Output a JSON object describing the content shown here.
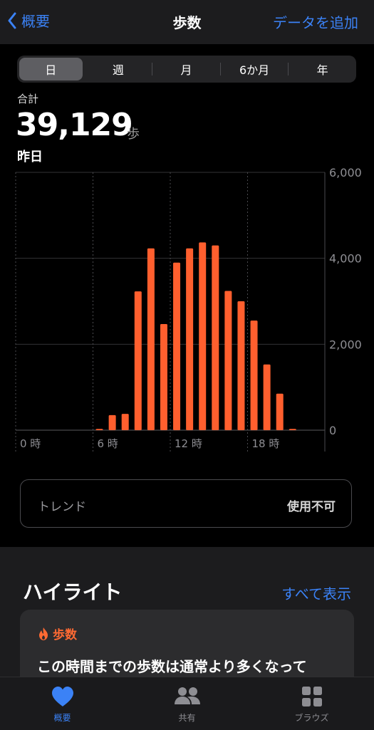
{
  "nav": {
    "back_label": "概要",
    "title": "歩数",
    "add_label": "データを追加"
  },
  "segments": [
    "日",
    "週",
    "月",
    "6か月",
    "年"
  ],
  "summary": {
    "label": "合計",
    "value": "39,129",
    "unit": "歩",
    "period": "昨日"
  },
  "colors": {
    "bar": "#ff5f2e",
    "accent": "#3b82f6",
    "highlight": "#ff6a33"
  },
  "chart_data": {
    "type": "bar",
    "x": [
      0,
      1,
      2,
      3,
      4,
      5,
      6,
      7,
      8,
      9,
      10,
      11,
      12,
      13,
      14,
      15,
      16,
      17,
      18,
      19,
      20,
      21,
      22,
      23
    ],
    "values": [
      0,
      0,
      0,
      0,
      0,
      0,
      30,
      350,
      380,
      3230,
      4230,
      2470,
      3900,
      4230,
      4370,
      4300,
      3240,
      3000,
      2550,
      1530,
      850,
      30,
      0,
      0
    ],
    "x_tick_labels": [
      "0 時",
      "6 時",
      "12 時",
      "18 時"
    ],
    "y_tick_labels": [
      "6,000",
      "4,000",
      "2,000",
      "0"
    ],
    "ylim": [
      0,
      6000
    ],
    "grid": true
  },
  "trend": {
    "label": "トレンド",
    "value": "使用不可"
  },
  "highlights": {
    "title": "ハイライト",
    "show_all": "すべて表示",
    "category": "歩数",
    "text": "この時間までの歩数は通常より多くなって"
  },
  "tabs": [
    {
      "label": "概要",
      "icon": "heart-icon"
    },
    {
      "label": "共有",
      "icon": "people-icon"
    },
    {
      "label": "ブラウズ",
      "icon": "grid-icon"
    }
  ]
}
